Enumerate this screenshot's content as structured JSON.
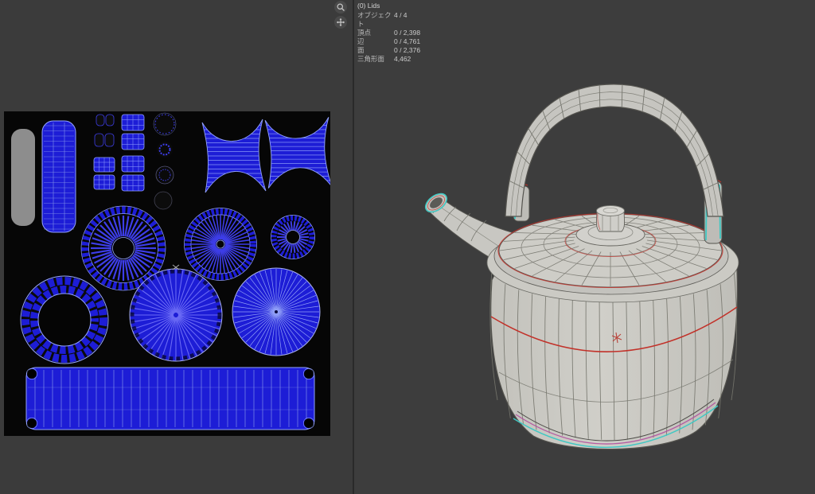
{
  "stats": {
    "collection": "(0) Lids",
    "rows": [
      {
        "label": "オブジェクト",
        "value": "4 / 4"
      },
      {
        "label": "頂点",
        "value": "0 / 2,398"
      },
      {
        "label": "辺",
        "value": "0 / 4,761"
      },
      {
        "label": "面",
        "value": "0 / 2,376"
      },
      {
        "label": "三角形面",
        "value": "4,462"
      }
    ]
  },
  "icons": {
    "zoom": "magnifier-glass",
    "move": "move-cross"
  },
  "colors": {
    "uv_blue": "#1d1dd6",
    "uv_spoke": "#3d3de8",
    "uv_wire": "#93a3ff",
    "uv_wire_soft": "#8292ea",
    "uv_bg": "#060606",
    "body": "#c7c6c1",
    "wire": "#75756d",
    "outline": "#54534e",
    "seam_red": "#c23129",
    "seam_cyan": "#40c8c3",
    "seam_magenta": "#b14f9f",
    "viewport_bg": "#3d3d3d",
    "editor_bg": "#3b3b3b"
  }
}
